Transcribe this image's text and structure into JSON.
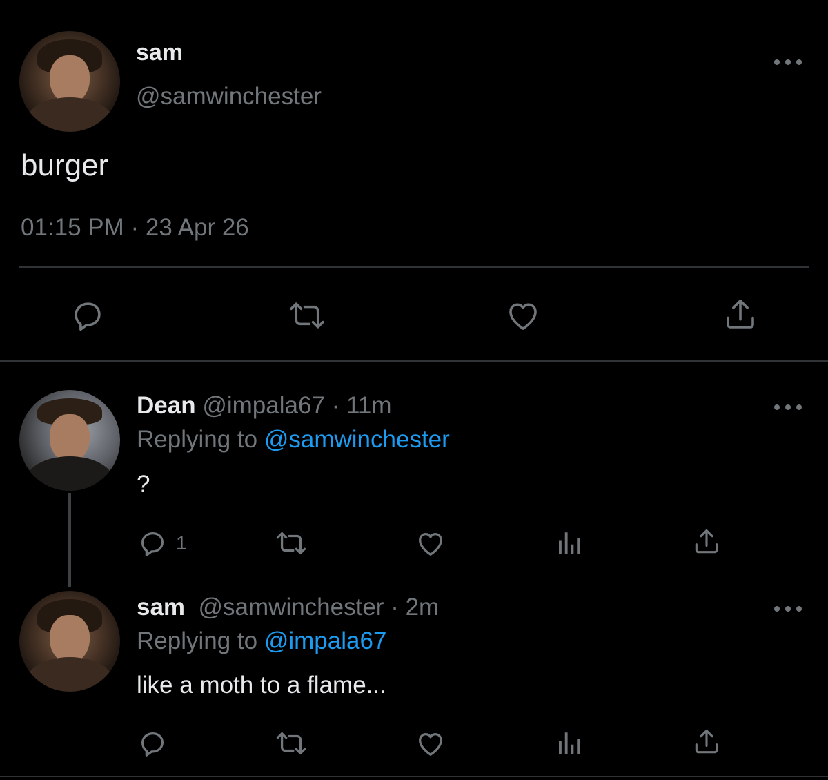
{
  "main_tweet": {
    "display_name": "sam",
    "handle": "@samwinchester",
    "text": "burger",
    "timestamp": "01:15 PM · 23 Apr 26",
    "actions": [
      "reply-icon",
      "retweet-icon",
      "like-icon",
      "share-icon"
    ]
  },
  "replies": [
    {
      "display_name": "Dean",
      "handle": "@impala67",
      "time": "11m",
      "replying_label": "Replying to",
      "replying_to": "@samwinchester",
      "text": "?",
      "reply_count": "1"
    },
    {
      "display_name": "sam",
      "handle": "@samwinchester",
      "time": "2m",
      "replying_label": "Replying to",
      "replying_to": "@impala67",
      "text": "like a moth to a flame..."
    }
  ],
  "colors": {
    "background": "#000000",
    "text": "#e7e9ea",
    "secondary": "#71767b",
    "link": "#1d9bf0",
    "divider": "#2f3336"
  }
}
